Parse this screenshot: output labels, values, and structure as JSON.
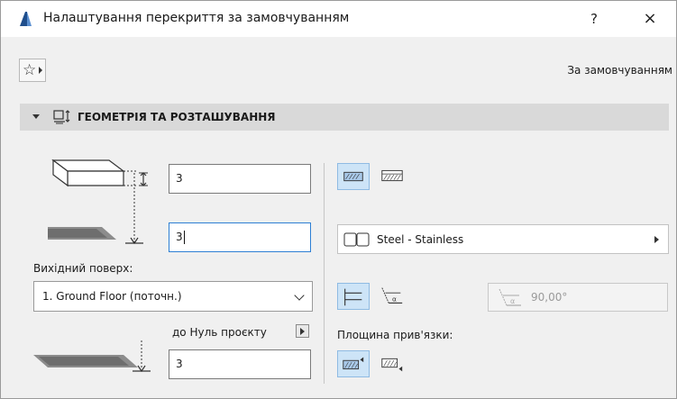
{
  "window": {
    "title": "Налаштування перекриття за замовчуванням",
    "help_label": "?",
    "close_label": "×"
  },
  "favorites": {
    "star_glyph": "☆",
    "default_label": "За замовчуванням"
  },
  "section": {
    "title": "ГЕОМЕТРІЯ ТА РОЗТАШУВАННЯ"
  },
  "geometry": {
    "thickness_value": "3",
    "offset_value": "3",
    "home_story_label": "Вихідний поверх:",
    "home_story_selected": "1. Ground Floor (поточн.)",
    "project_zero_label": "до Нуль проєкту",
    "project_zero_value": "3"
  },
  "structure": {
    "material_name": "Steel - Stainless",
    "angle_value": "90,00°",
    "reference_plane_label": "Площина прив'язки:"
  },
  "colors": {
    "accent_blue": "#2d7fd4",
    "active_toggle_bg": "#cde4f7",
    "section_header_bg": "#d9d9d9",
    "window_bg": "#f0f0f0"
  }
}
